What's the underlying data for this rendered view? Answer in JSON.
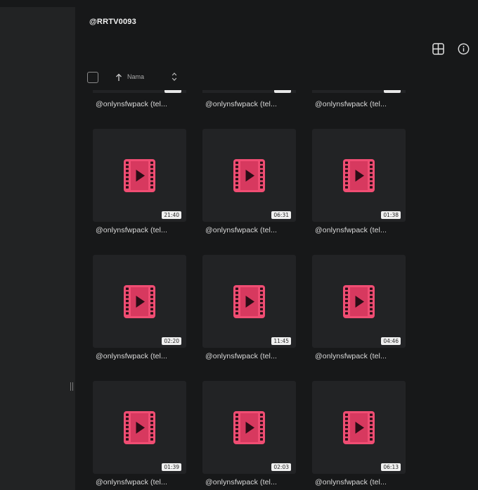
{
  "folder": {
    "title": "@RRTV0093"
  },
  "toolbar": {
    "sort_label": "Nama",
    "grid_view_icon": "grid-view-icon",
    "info_icon": "info-icon"
  },
  "colors": {
    "background": "#171819",
    "sidebar": "#222324",
    "tile": "#222325",
    "video_icon": "#f04d73"
  },
  "files": [
    {
      "name": "@onlynsfwpack (tel...",
      "duration": ""
    },
    {
      "name": "@onlynsfwpack (tel...",
      "duration": ""
    },
    {
      "name": "@onlynsfwpack (tel...",
      "duration": ""
    },
    {
      "name": "@onlynsfwpack (tel...",
      "duration": "21:40"
    },
    {
      "name": "@onlynsfwpack (tel...",
      "duration": "06:31"
    },
    {
      "name": "@onlynsfwpack (tel...",
      "duration": "01:38"
    },
    {
      "name": "@onlynsfwpack (tel...",
      "duration": "02:20"
    },
    {
      "name": "@onlynsfwpack (tel...",
      "duration": "11:45"
    },
    {
      "name": "@onlynsfwpack (tel...",
      "duration": "04:46"
    },
    {
      "name": "@onlynsfwpack (tel...",
      "duration": "01:39"
    },
    {
      "name": "@onlynsfwpack (tel...",
      "duration": "02:03"
    },
    {
      "name": "@onlynsfwpack (tel...",
      "duration": "06:13"
    }
  ]
}
